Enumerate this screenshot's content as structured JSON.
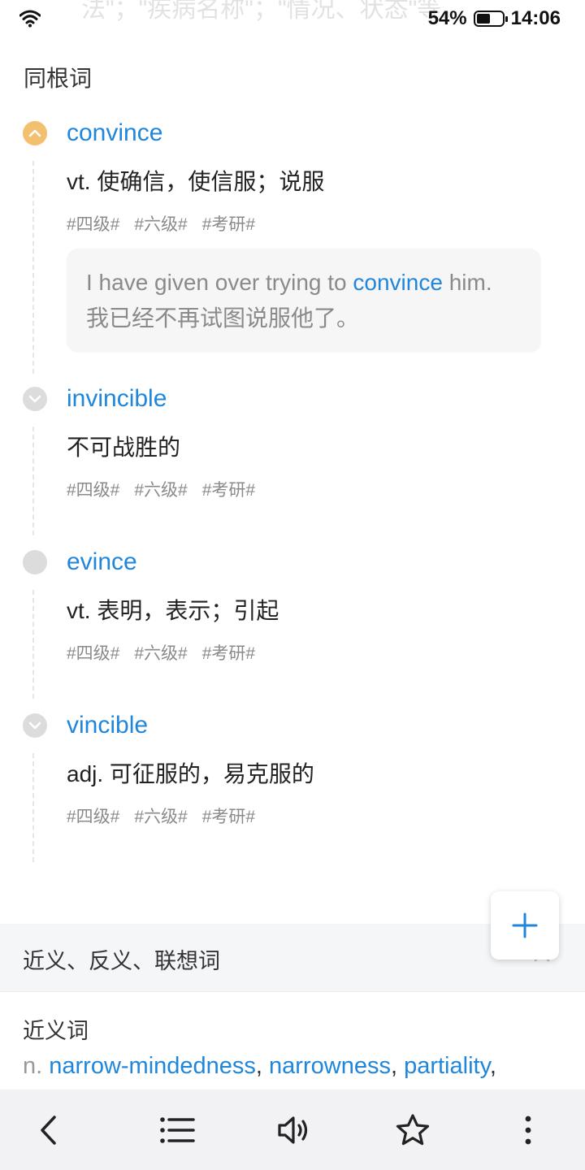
{
  "status_bar": {
    "ghost_text": "法\"；\"疾病名称\"；\"情况、状态\"等。",
    "battery_percent": "54%",
    "battery_level": 0.54,
    "time": "14:06"
  },
  "cognates": {
    "title": "同根词",
    "items": [
      {
        "word": "convince",
        "definition": "vt. 使确信，使信服；说服",
        "tags": [
          "#四级#",
          "#六级#",
          "#考研#"
        ],
        "expanded": true,
        "dot_color": "#f2c06e",
        "example": {
          "en_before": "I have given over trying to ",
          "en_highlight": "convince",
          "en_after": " him.",
          "zh": "我已经不再试图说服他了。"
        }
      },
      {
        "word": "invincible",
        "definition": "不可战胜的",
        "tags": [
          "#四级#",
          "#六级#",
          "#考研#"
        ]
      },
      {
        "word": "evince",
        "definition": "vt. 表明，表示；引起",
        "tags": [
          "#四级#",
          "#六级#",
          "#考研#"
        ]
      },
      {
        "word": "vincible",
        "definition": "adj. 可征服的，易克服的",
        "tags": [
          "#四级#",
          "#六级#",
          "#考研#"
        ]
      }
    ]
  },
  "related": {
    "title": "近义、反义、联想词",
    "synonyms_title": "近义词",
    "synonyms_pos": "n.",
    "synonyms": [
      "narrow-mindedness",
      "narrowness",
      "partiality"
    ]
  },
  "toolbar": {
    "icons": [
      "back-icon",
      "list-icon",
      "speaker-icon",
      "star-icon",
      "more-icon"
    ]
  },
  "colors": {
    "accent": "#1f86db",
    "dot_expanded": "#f2c06e",
    "dot_collapsed": "#dcdcdc"
  }
}
